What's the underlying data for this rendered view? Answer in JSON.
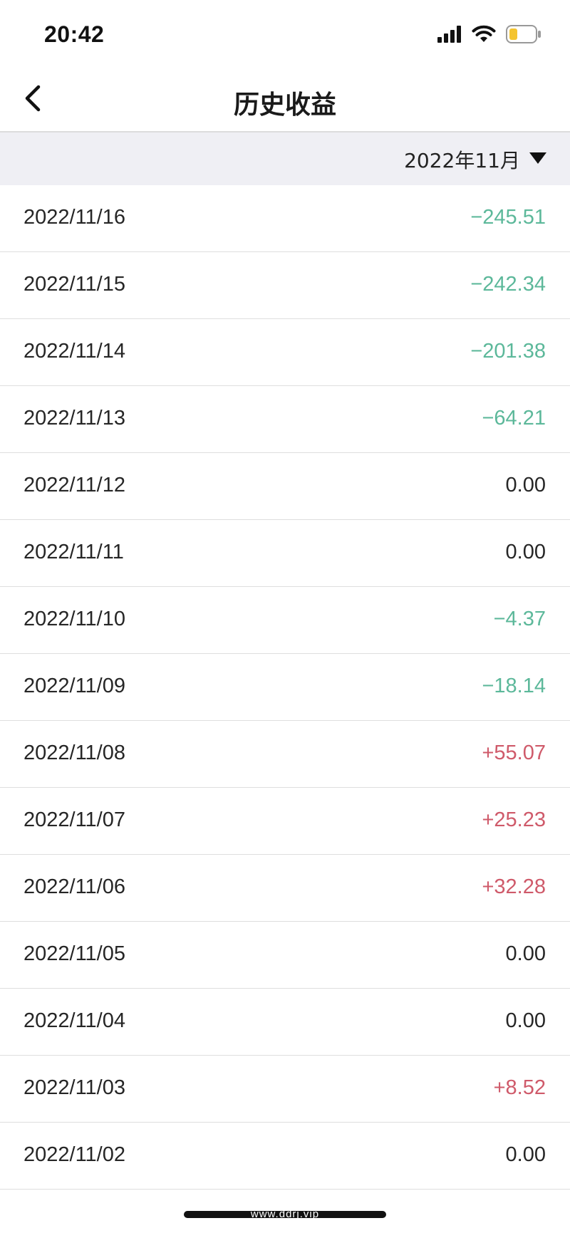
{
  "status_bar": {
    "time": "20:42",
    "icons": [
      "signal-icon",
      "wifi-icon",
      "battery-icon"
    ],
    "battery_color": "#f4c430"
  },
  "nav": {
    "title": "历史收益",
    "back_icon": "chevron-left-icon"
  },
  "filter": {
    "month": "2022年11月",
    "dropdown_icon": "triangle-down-icon"
  },
  "colors": {
    "negative": "#5cb89a",
    "positive": "#cf5a6a",
    "neutral": "#262626",
    "filter_background": "#efeff4"
  },
  "rows": [
    {
      "date": "2022/11/16",
      "amount": "−245.51",
      "sign": "neg"
    },
    {
      "date": "2022/11/15",
      "amount": "−242.34",
      "sign": "neg"
    },
    {
      "date": "2022/11/14",
      "amount": "−201.38",
      "sign": "neg"
    },
    {
      "date": "2022/11/13",
      "amount": "−64.21",
      "sign": "neg"
    },
    {
      "date": "2022/11/12",
      "amount": "0.00",
      "sign": "zero"
    },
    {
      "date": "2022/11/11",
      "amount": "0.00",
      "sign": "zero"
    },
    {
      "date": "2022/11/10",
      "amount": "−4.37",
      "sign": "neg"
    },
    {
      "date": "2022/11/09",
      "amount": "−18.14",
      "sign": "neg"
    },
    {
      "date": "2022/11/08",
      "amount": "+55.07",
      "sign": "pos"
    },
    {
      "date": "2022/11/07",
      "amount": "+25.23",
      "sign": "pos"
    },
    {
      "date": "2022/11/06",
      "amount": "+32.28",
      "sign": "pos"
    },
    {
      "date": "2022/11/05",
      "amount": "0.00",
      "sign": "zero"
    },
    {
      "date": "2022/11/04",
      "amount": "0.00",
      "sign": "zero"
    },
    {
      "date": "2022/11/03",
      "amount": "+8.52",
      "sign": "pos"
    },
    {
      "date": "2022/11/02",
      "amount": "0.00",
      "sign": "zero"
    }
  ],
  "watermark": "www.ddrj.vip"
}
